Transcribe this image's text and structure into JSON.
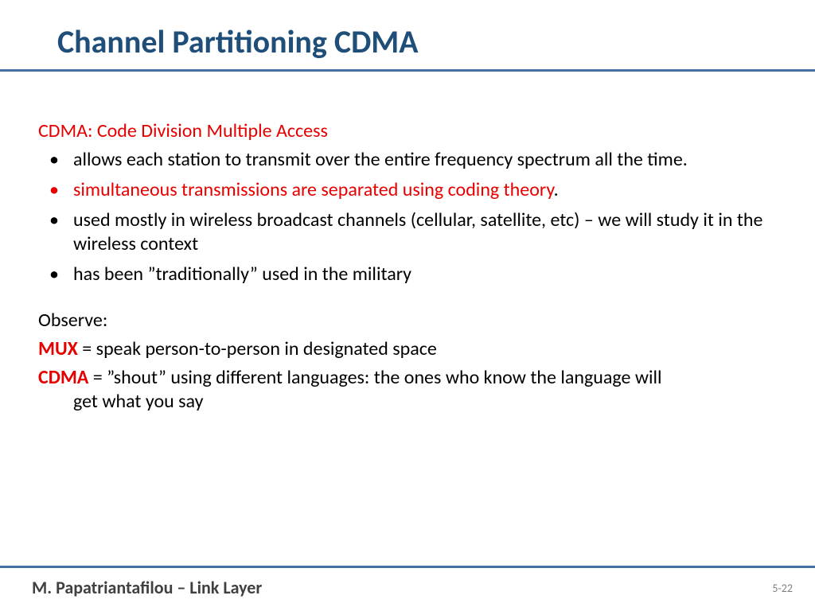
{
  "title": "Channel Partitioning CDMA",
  "heading": "CDMA: Code Division Multiple Access",
  "bullets": {
    "b1": "allows each station to transmit over the entire frequency spectrum all the time.",
    "b2_red": "simultaneous transmissions are separated using coding theory",
    "b2_dot": ".",
    "b3": "used mostly in wireless broadcast channels (cellular, satellite, etc) – we will study it in the wireless context",
    "b4": "has been ”traditionally” used in the military"
  },
  "observe": "Observe:",
  "mux": {
    "label": "MUX",
    "rest": " = speak person-to-person in designated space"
  },
  "cdma": {
    "label": "CDMA",
    "rest_line1": " = ”shout” using different languages: the ones who know the language will",
    "rest_line2": "get what you say"
  },
  "footer": {
    "author": "M. Papatriantafilou –  Link Layer",
    "page": "5-22"
  }
}
